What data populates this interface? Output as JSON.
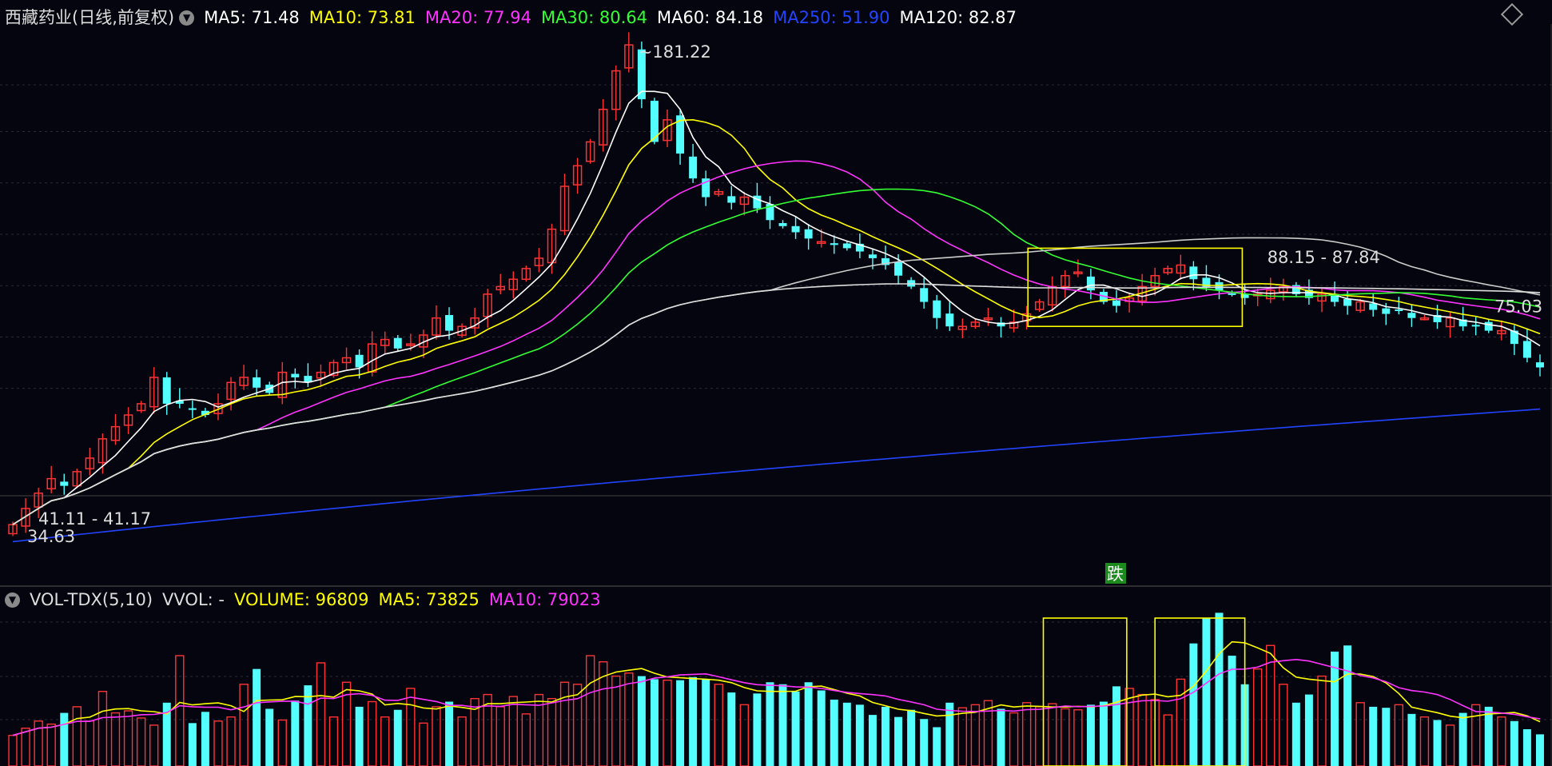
{
  "price_header": {
    "name": "西藏药业(日线,前复权)",
    "ma": [
      {
        "text": "MA5: 71.48",
        "color": "#ffffff"
      },
      {
        "text": "MA10: 73.81",
        "color": "#ffff00"
      },
      {
        "text": "MA20: 77.94",
        "color": "#ff33ff"
      },
      {
        "text": "MA30: 80.64",
        "color": "#33ff33"
      },
      {
        "text": "MA60: 84.18",
        "color": "#ffffff"
      },
      {
        "text": "MA250: 51.90",
        "color": "#2244ff"
      },
      {
        "text": "MA120: 82.87",
        "color": "#ffffff"
      }
    ]
  },
  "vol_header": {
    "items": [
      {
        "text": "VOL-TDX(5,10)",
        "color": "#dddddd"
      },
      {
        "text": "VVOL: -",
        "color": "#dddddd"
      },
      {
        "text": "VOLUME: 96809",
        "color": "#ffff00"
      },
      {
        "text": "MA5: 73825",
        "color": "#ffff00"
      },
      {
        "text": "MA10: 79023",
        "color": "#ff33ff"
      }
    ]
  },
  "chart_data": {
    "type": "candlestick",
    "x_days": 120,
    "y_scale": "log",
    "ylim": [
      32,
      190
    ],
    "annotations": {
      "high": "181.22",
      "low_label": "34.63",
      "range_left": "41.11 - 41.17",
      "range_right": "88.15 - 87.84",
      "right_value": "75.03",
      "badge": "跌"
    },
    "colors": {
      "up": "#ff3333",
      "down": "#54ffff",
      "ma5": "#ffffff",
      "ma10": "#ffff00",
      "ma20": "#ff33ff",
      "ma30": "#33ff33",
      "ma60": "#cccccc",
      "ma250": "#2244ff",
      "ma120": "#dddddd",
      "box": "#ffff00"
    },
    "closes": [
      36,
      38,
      40,
      42,
      41,
      43,
      45,
      48,
      50,
      52,
      54,
      59,
      54,
      54,
      53,
      52,
      54,
      58,
      59,
      57,
      56,
      60,
      59,
      58,
      60,
      62,
      63,
      61,
      66,
      67,
      65,
      66,
      68,
      72,
      69,
      70,
      72,
      78,
      80,
      82,
      85,
      88,
      97,
      112,
      120,
      130,
      145,
      165,
      180,
      150,
      130,
      140,
      125,
      115,
      108,
      110,
      106,
      108,
      104,
      100,
      98,
      96,
      94,
      93,
      92,
      91,
      90,
      88,
      86,
      83,
      80,
      76,
      72,
      70,
      70,
      71,
      72,
      70,
      71,
      73,
      76,
      80,
      83,
      84,
      79,
      76,
      75,
      77,
      80,
      83,
      85,
      86,
      82,
      80,
      79,
      78,
      77,
      78,
      79,
      80,
      78,
      77,
      78,
      76,
      75,
      76,
      74,
      73,
      74,
      72,
      72,
      71,
      72,
      70,
      70,
      69,
      69,
      66,
      63,
      61
    ],
    "volume": [
      30,
      37,
      44,
      41,
      52,
      58,
      44,
      73,
      52,
      54,
      47,
      40,
      62,
      108,
      42,
      53,
      44,
      48,
      80,
      95,
      56,
      45,
      64,
      79,
      101,
      48,
      82,
      58,
      63,
      48,
      55,
      76,
      42,
      58,
      63,
      48,
      66,
      70,
      58,
      68,
      51,
      70,
      66,
      82,
      80,
      108,
      102,
      88,
      91,
      88,
      85,
      84,
      84,
      87,
      85,
      80,
      72,
      60,
      71,
      82,
      80,
      73,
      82,
      74,
      65,
      62,
      60,
      50,
      58,
      48,
      55,
      46,
      38,
      62,
      57,
      60,
      64,
      56,
      52,
      62,
      58,
      61,
      56,
      55,
      60,
      63,
      78,
      76,
      70,
      65,
      50,
      85,
      120,
      145,
      150,
      108,
      80,
      95,
      118,
      80,
      62,
      70,
      88,
      112,
      118,
      62,
      58,
      57,
      60,
      51,
      48,
      45,
      40,
      52,
      60,
      58,
      48,
      44,
      36,
      31
    ],
    "y_axis_ticks": [],
    "boxes": [
      {
        "x0": 79.6,
        "x1": 96.3,
        "pmin": 70,
        "pmax": 91
      },
      {
        "vx0": 80.8,
        "vx1": 87.3,
        "vx2": 89.5,
        "vx3": 96.5
      }
    ]
  }
}
